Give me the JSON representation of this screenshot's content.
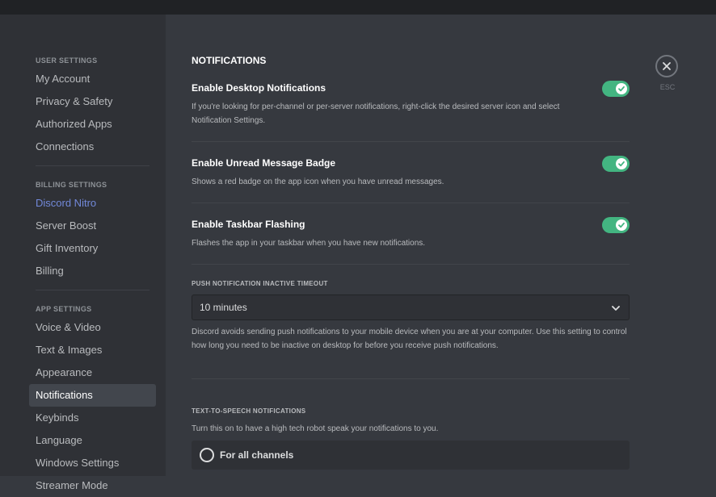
{
  "sidebar": {
    "sections": [
      {
        "header": "USER SETTINGS",
        "items": [
          "My Account",
          "Privacy & Safety",
          "Authorized Apps",
          "Connections"
        ]
      },
      {
        "header": "BILLING SETTINGS",
        "items": [
          "Discord Nitro",
          "Server Boost",
          "Gift Inventory",
          "Billing"
        ]
      },
      {
        "header": "APP SETTINGS",
        "items": [
          "Voice & Video",
          "Text & Images",
          "Appearance",
          "Notifications",
          "Keybinds",
          "Language",
          "Windows Settings",
          "Streamer Mode"
        ]
      }
    ],
    "selected": "Notifications"
  },
  "main": {
    "title": "NOTIFICATIONS",
    "desktop": {
      "title": "Enable Desktop Notifications",
      "desc": "If you're looking for per-channel or per-server notifications, right-click the desired server icon and select Notification Settings.",
      "enabled": true
    },
    "badge": {
      "title": "Enable Unread Message Badge",
      "desc": "Shows a red badge on the app icon when you have unread messages.",
      "enabled": true
    },
    "taskbar": {
      "title": "Enable Taskbar Flashing",
      "desc": "Flashes the app in your taskbar when you have new notifications.",
      "enabled": true
    },
    "push": {
      "label": "PUSH NOTIFICATION INACTIVE TIMEOUT",
      "value": "10 minutes",
      "desc": "Discord avoids sending push notifications to your mobile device when you are at your computer. Use this setting to control how long you need to be inactive on desktop for before you receive push notifications."
    },
    "tts": {
      "label": "TEXT-TO-SPEECH NOTIFICATIONS",
      "desc": "Turn this on to have a high tech robot speak your notifications to you.",
      "option1": "For all channels"
    }
  },
  "close": {
    "label": "ESC",
    "icon": "close-icon"
  },
  "colors": {
    "toggle_on": "#43b581",
    "accent": "#7289da",
    "background": "#36393f",
    "sidebar": "#2f3136"
  }
}
